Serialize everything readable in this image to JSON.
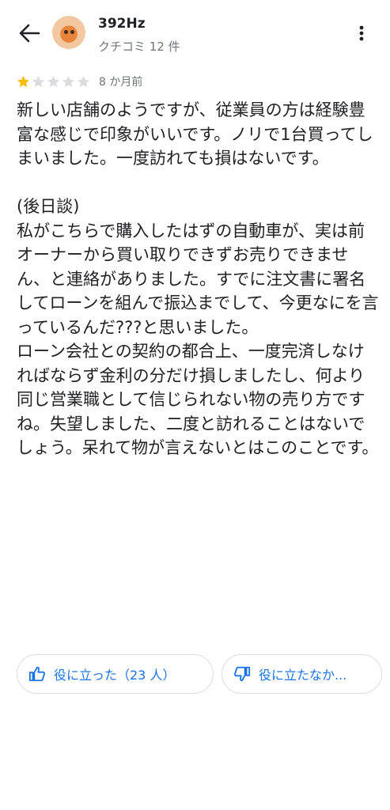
{
  "header": {
    "user_name": "392Hz",
    "review_count": "クチコミ 12 件",
    "back_icon": "arrow-left-icon",
    "more_icon": "more-vert-icon"
  },
  "review": {
    "rating": 1,
    "max_rating": 5,
    "date": "8 か月前",
    "text": "新しい店舗のようですが、従業員の方は経験豊富な感じで印象がいいです。ノリで1台買ってしまいました。一度訪れても損はないです。\n\n(後日談)\n私がこちらで購入したはずの自動車が、実は前オーナーから買い取りできずお売りできません、と連絡がありました。すでに注文書に署名してローンを組んで振込までして、今更なにを言っているんだ???と思いました。\nローン会社との契約の都合上、一度完済しなければならず金利の分だけ損しましたし、何より同じ営業職として信じられない物の売り方ですね。失望しました、二度と訪れることはないでしょう。呆れて物が言えないとはこのことです。"
  },
  "actions": {
    "helpful_label": "役に立った（23 人）",
    "not_helpful_label": "役に立たなか..."
  },
  "colors": {
    "star_filled": "#fbbc04",
    "star_empty": "#dadce0",
    "accent": "#1a73e8"
  }
}
